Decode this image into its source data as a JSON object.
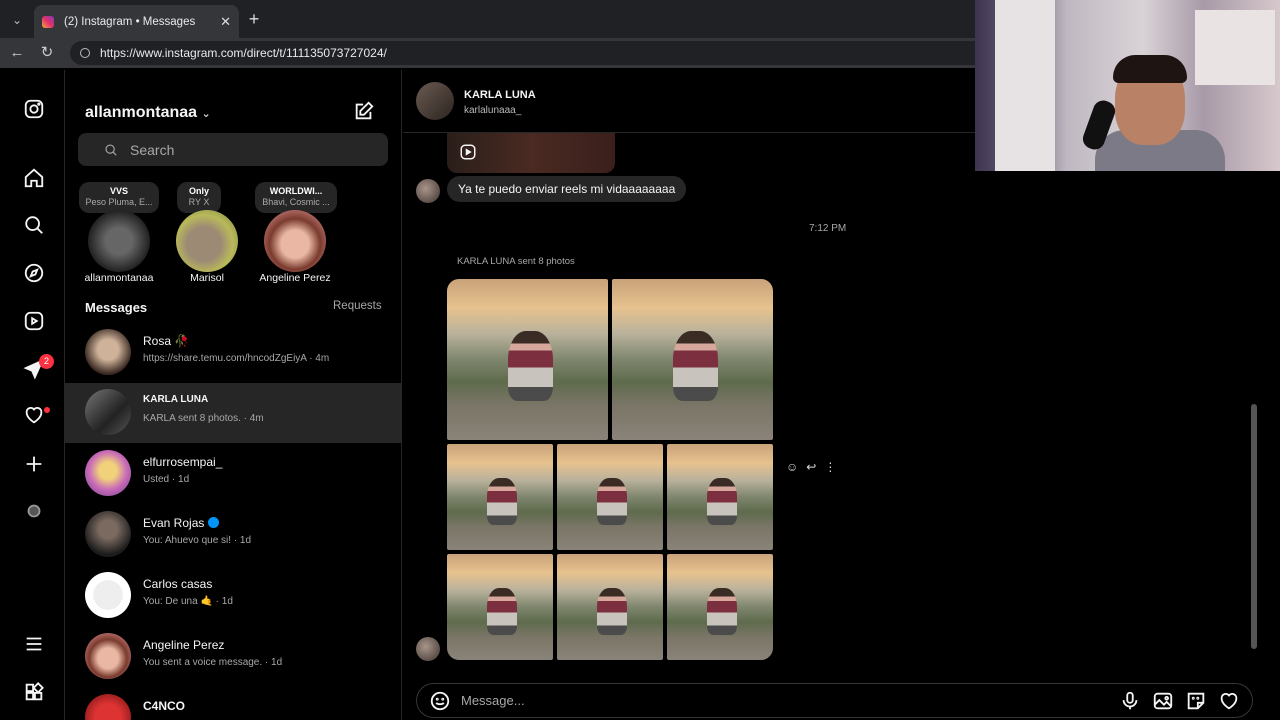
{
  "browser": {
    "tab_title": "(2) Instagram • Messages",
    "tab_close": "✕",
    "new_tab": "+",
    "url": "https://www.instagram.com/direct/t/111135073727024/"
  },
  "rail": {
    "notifications_badge": "2",
    "icons": [
      "instagram-logo-icon",
      "home-icon",
      "search-icon",
      "explore-icon",
      "reels-icon",
      "messages-icon",
      "heart-icon",
      "create-icon",
      "profile-icon",
      "menu-icon",
      "more-icon"
    ]
  },
  "panel": {
    "username": "allanmontanaa",
    "search_placeholder": "Search",
    "notes": [
      {
        "title": "VVS",
        "sub": "Peso Pluma, E...",
        "avatar_label": "allanmontanaa"
      },
      {
        "title": "Only",
        "sub": "RY X",
        "avatar_label": "Marisol"
      },
      {
        "title": "WORLDWI...",
        "sub": "Bhavi, Cosmic ...",
        "avatar_label": "Angeline Perez"
      }
    ],
    "messages_heading": "Messages",
    "requests_label": "Requests",
    "threads": [
      {
        "name": "Rosa 🥀",
        "sub": "https://share.temu.com/hncodZgEiyA · 4m"
      },
      {
        "name": "KARLA LUNA",
        "sub": "KARLA sent 8 photos. · 4m"
      },
      {
        "name": "elfurrosempai_",
        "sub": "Usted · 1d"
      },
      {
        "name": "Evan Rojas",
        "sub": "You: Ahuevo que si! · 1d"
      },
      {
        "name": "Carlos casas",
        "sub": "You: De una 🤙 · 1d"
      },
      {
        "name": "Angeline Perez",
        "sub": "You sent a voice message. · 1d"
      },
      {
        "name": "C4NCO",
        "sub": ""
      }
    ]
  },
  "chat": {
    "contact_name": "KARLA LUNA",
    "contact_username": "karlalunaaa_",
    "message_text": "Ya te puedo enviar reels mi vidaaaaaaaa",
    "timestamp": "7:12 PM",
    "sent_label": "KARLA LUNA sent 8 photos",
    "photo_count": 8,
    "input_placeholder": "Message...",
    "input_icons": [
      "mic-icon",
      "image-icon",
      "sticker-icon",
      "heart-icon"
    ]
  }
}
